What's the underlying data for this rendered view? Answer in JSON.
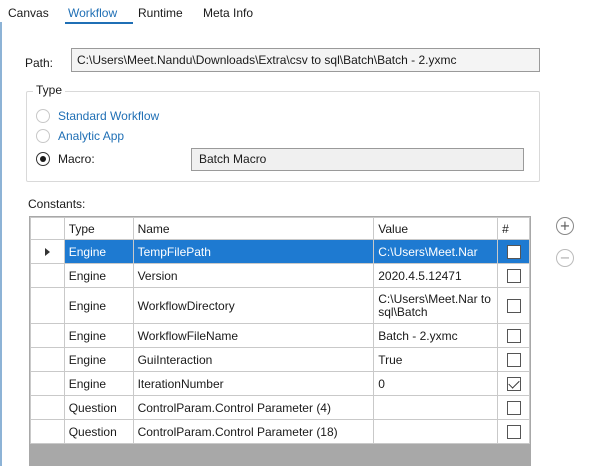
{
  "tabs": [
    {
      "label": "Canvas"
    },
    {
      "label": "Workflow"
    },
    {
      "label": "Runtime"
    },
    {
      "label": "Meta Info"
    }
  ],
  "path": {
    "label": "Path:",
    "value": "C:\\Users\\Meet.Nandu\\Downloads\\Extra\\csv to sql\\Batch\\Batch - 2.yxmc"
  },
  "type_group": {
    "legend": "Type",
    "options": [
      {
        "label": "Standard Workflow",
        "checked": false
      },
      {
        "label": "Analytic App",
        "checked": false
      },
      {
        "label": "Macro:",
        "checked": true
      }
    ],
    "macro_value": "Batch Macro"
  },
  "constants": {
    "label": "Constants:",
    "columns": [
      "Type",
      "Name",
      "Value",
      "#"
    ],
    "rows": [
      {
        "type": "Engine",
        "name": "TempFilePath",
        "value": "C:\\Users\\Meet.Nar",
        "checked": false,
        "selected": true
      },
      {
        "type": "Engine",
        "name": "Version",
        "value": "2020.4.5.12471",
        "checked": false
      },
      {
        "type": "Engine",
        "name": "WorkflowDirectory",
        "value": "C:\\Users\\Meet.Nar to sql\\Batch",
        "checked": false
      },
      {
        "type": "Engine",
        "name": "WorkflowFileName",
        "value": "Batch - 2.yxmc",
        "checked": false
      },
      {
        "type": "Engine",
        "name": "GuiInteraction",
        "value": "True",
        "checked": false
      },
      {
        "type": "Engine",
        "name": "IterationNumber",
        "value": "0",
        "checked": true
      },
      {
        "type": "Question",
        "name": "ControlParam.Control Parameter (4)",
        "value": "",
        "checked": false
      },
      {
        "type": "Question",
        "name": "ControlParam.Control Parameter (18)",
        "value": "",
        "checked": false
      }
    ]
  },
  "buttons": {
    "add_icon": "plus-circle-icon",
    "remove_icon": "minus-circle-icon"
  }
}
